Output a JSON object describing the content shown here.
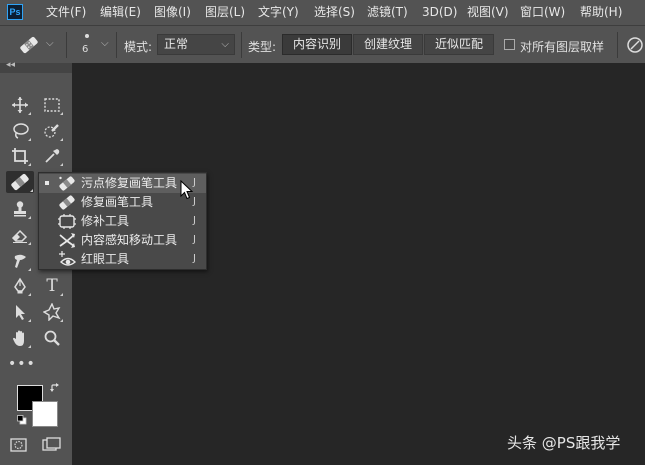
{
  "app": {
    "logo": "Ps"
  },
  "menu": [
    "文件(F)",
    "编辑(E)",
    "图像(I)",
    "图层(L)",
    "文字(Y)",
    "选择(S)",
    "滤镜(T)",
    "3D(D)",
    "视图(V)",
    "窗口(W)",
    "帮助(H)"
  ],
  "options": {
    "brush_size": "6",
    "mode_label": "模式:",
    "mode_value": "正常",
    "type_label": "类型:",
    "types": [
      "内容识别",
      "创建纹理",
      "近似匹配"
    ],
    "active_type": 0,
    "sample_all_layers": "对所有图层取样"
  },
  "flyout": {
    "items": [
      {
        "label": "污点修复画笔工具",
        "key": "J",
        "icon": "spot-healing-brush-icon"
      },
      {
        "label": "修复画笔工具",
        "key": "J",
        "icon": "healing-brush-icon"
      },
      {
        "label": "修补工具",
        "key": "J",
        "icon": "patch-icon"
      },
      {
        "label": "内容感知移动工具",
        "key": "J",
        "icon": "content-aware-move-icon"
      },
      {
        "label": "红眼工具",
        "key": "J",
        "icon": "red-eye-icon"
      }
    ],
    "selected": 0
  },
  "toolbar": {
    "collapse": "◂◂"
  },
  "watermark": "头条 @PS跟我学"
}
